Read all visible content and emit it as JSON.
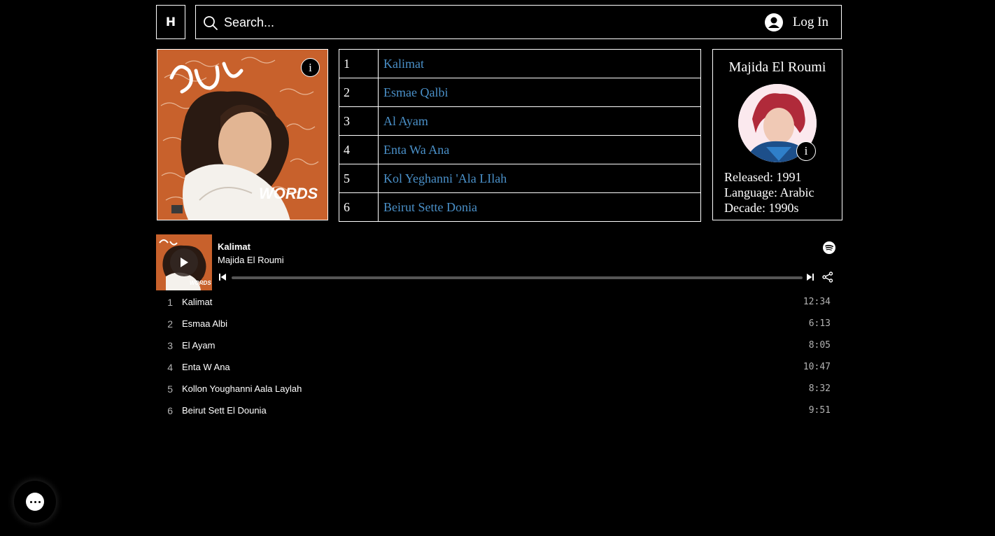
{
  "header": {
    "logo_letter": "H",
    "search_placeholder": "Search...",
    "login_label": "Log In"
  },
  "album": {
    "cover_icon": "album-cover-image",
    "info_label": "i",
    "tracks": [
      {
        "num": "1",
        "title": "Kalimat"
      },
      {
        "num": "2",
        "title": "Esmae Qalbi"
      },
      {
        "num": "3",
        "title": "Al Ayam"
      },
      {
        "num": "4",
        "title": "Enta Wa Ana"
      },
      {
        "num": "5",
        "title": "Kol Yeghanni 'Ala LIlah"
      },
      {
        "num": "6",
        "title": "Beirut Sette Donia"
      }
    ]
  },
  "artist": {
    "name": "Majida El Roumi",
    "info_label": "i",
    "released": "Released: 1991",
    "language": "Language: Arabic",
    "decade": "Decade: 1990s"
  },
  "player": {
    "title": "Kalimat",
    "artist": "Majida El Roumi",
    "progress": 0,
    "tracks": [
      {
        "num": "1",
        "title": "Kalimat",
        "duration": "12:34"
      },
      {
        "num": "2",
        "title": "Esmaa Albi",
        "duration": "6:13"
      },
      {
        "num": "3",
        "title": "El Ayam",
        "duration": "8:05"
      },
      {
        "num": "4",
        "title": "Enta W Ana",
        "duration": "10:47"
      },
      {
        "num": "5",
        "title": "Kollon Youghanni Aala Laylah",
        "duration": "8:32"
      },
      {
        "num": "6",
        "title": "Beirut Sett El Dounia",
        "duration": "9:51"
      }
    ]
  },
  "colors": {
    "background": "#000000",
    "link": "#4a90c8",
    "cover_orange": "#c8612c"
  }
}
